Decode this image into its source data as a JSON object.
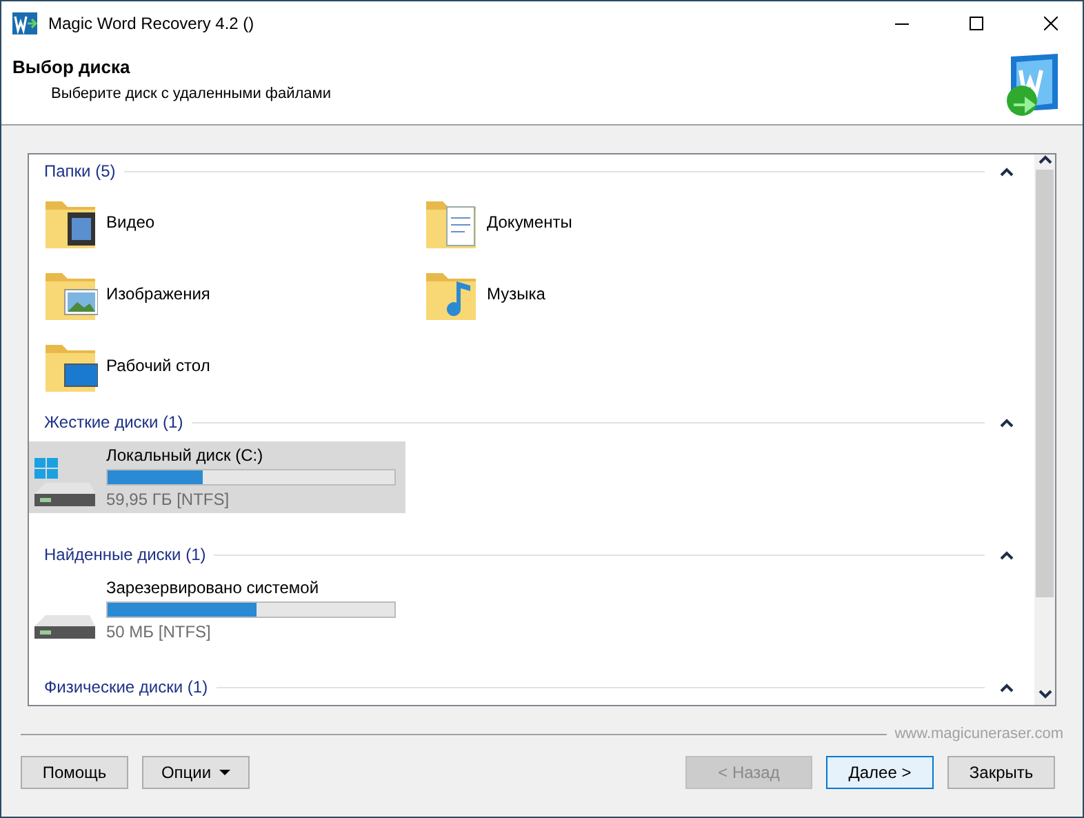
{
  "window": {
    "title": "Magic Word Recovery 4.2 ()"
  },
  "header": {
    "title": "Выбор диска",
    "subtitle": "Выберите диск с удаленными файлами"
  },
  "groups": [
    {
      "title": "Папки (5)",
      "expanded": true,
      "kind": "folders",
      "items": [
        {
          "name": "Видео",
          "kind": "video"
        },
        {
          "name": "Документы",
          "kind": "documents"
        },
        {
          "name": "Изображения",
          "kind": "pictures"
        },
        {
          "name": "Музыка",
          "kind": "music"
        },
        {
          "name": "Рабочий стол",
          "kind": "desktop"
        }
      ]
    },
    {
      "title": "Жесткие диски (1)",
      "expanded": true,
      "kind": "disks",
      "items": [
        {
          "name": "Локальный диск (C:)",
          "size": "59,95 ГБ [NTFS]",
          "level": 0.33,
          "selected": true,
          "kind": "system"
        }
      ]
    },
    {
      "title": "Найденные диски (1)",
      "expanded": true,
      "kind": "disks",
      "items": [
        {
          "name": "Зарезервировано системой",
          "size": "50 МБ [NTFS]",
          "level": 0.52,
          "selected": false,
          "kind": "plain"
        }
      ]
    },
    {
      "title": "Физические диски (1)",
      "expanded": true,
      "kind": "disks"
    }
  ],
  "footer": {
    "website": "www.magicuneraser.com"
  },
  "buttons": [
    {
      "label": "Помощь",
      "kind": "plain",
      "disabled": false,
      "focused": false
    },
    {
      "label": "Опции",
      "kind": "menu",
      "disabled": false,
      "focused": false
    },
    {
      "label": "< Назад",
      "kind": "plain",
      "disabled": true,
      "focused": false
    },
    {
      "label": "Далее >",
      "kind": "plain",
      "disabled": false,
      "focused": true
    },
    {
      "label": "Закрыть",
      "kind": "plain",
      "disabled": false,
      "focused": false
    }
  ]
}
